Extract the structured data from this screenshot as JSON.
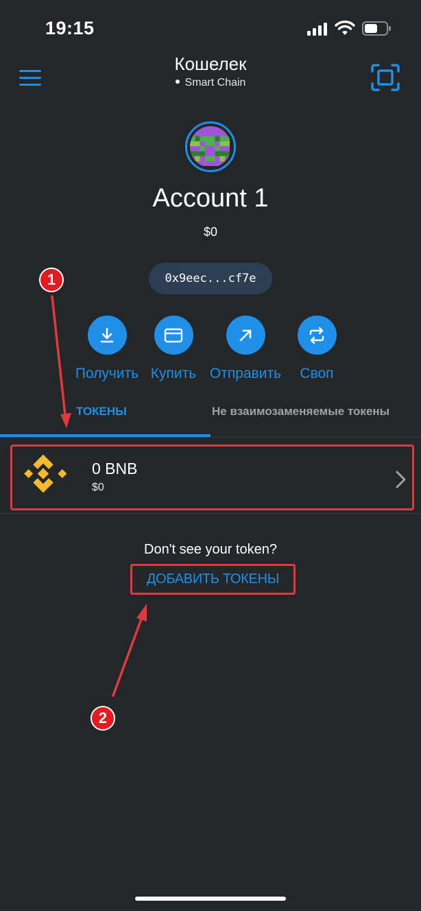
{
  "status_bar": {
    "time": "19:15"
  },
  "header": {
    "title": "Кошелек",
    "network": "Smart Chain"
  },
  "account": {
    "name": "Account 1",
    "balance": "$0",
    "address": "0x9eec...cf7e"
  },
  "actions": [
    {
      "label": "Получить",
      "icon": "download-icon"
    },
    {
      "label": "Купить",
      "icon": "card-icon"
    },
    {
      "label": "Отправить",
      "icon": "arrow-up-right-icon"
    },
    {
      "label": "Своп",
      "icon": "swap-icon"
    }
  ],
  "tabs": [
    {
      "label": "ТОКЕНЫ",
      "active": true
    },
    {
      "label": "Не взаимозаменяемые токены",
      "active": false
    }
  ],
  "tokens": [
    {
      "amount": "0 BNB",
      "value": "$0",
      "icon": "bnb-logo-icon"
    }
  ],
  "empty_hint": "Don't see your token?",
  "add_tokens_label": "ДОБАВИТЬ ТОКЕНЫ",
  "annotations": [
    "1",
    "2"
  ],
  "colors": {
    "background": "#24272a",
    "accent": "#1f8fe7",
    "annotation": "#e0393e",
    "bnb": "#f3ba2f"
  }
}
